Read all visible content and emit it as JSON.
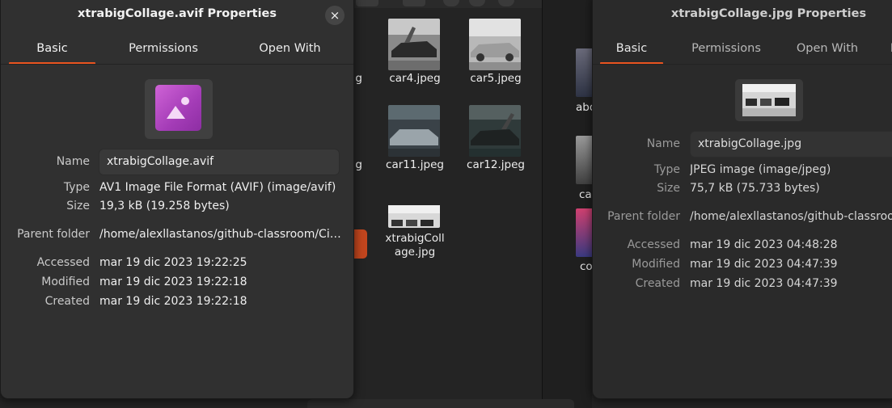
{
  "left_dialog": {
    "title": "xtrabigCollage.avif Properties",
    "close_icon": "×",
    "tabs": [
      "Basic",
      "Permissions",
      "Open With"
    ],
    "file_icon": "image-file-icon",
    "name_label": "Name",
    "name_value": "xtrabigCollage.avif",
    "type_label": "Type",
    "type_value": "AV1 Image File Format (AVIF) (image/avif)",
    "size_label": "Size",
    "size_value": "19,3 kB (19.258 bytes)",
    "parent_label": "Parent folder",
    "parent_value": "/home/alexllastanos/github-classroom/Ci…",
    "accessed_label": "Accessed",
    "accessed_value": "mar 19 dic 2023 19:22:25",
    "modified_label": "Modified",
    "modified_value": "mar 19 dic 2023 19:22:18",
    "created_label": "Created",
    "created_value": "mar 19 dic 2023 19:22:18"
  },
  "right_dialog": {
    "title": "xtrabigCollage.jpg Properties",
    "tabs": [
      "Basic",
      "Permissions",
      "Open With",
      "I"
    ],
    "name_label": "Name",
    "name_value": "xtrabigCollage.jpg",
    "type_label": "Type",
    "type_value": "JPEG image (image/jpeg)",
    "size_label": "Size",
    "size_value": "75,7 kB (75.733 bytes)",
    "parent_label": "Parent folder",
    "parent_value": "/home/alexllastanos/github-classroom",
    "accessed_label": "Accessed",
    "accessed_value": "mar 19 dic 2023 04:48:28",
    "modified_label": "Modified",
    "modified_value": "mar 19 dic 2023 04:47:39",
    "created_label": "Created",
    "created_value": "mar 19 dic 2023 04:47:39"
  },
  "file_grid": {
    "items": [
      "car4.jpeg",
      "car5.jpeg",
      "car11.jpeg",
      "car12.jpeg",
      "xtrabigColl",
      "age.jpg"
    ],
    "partial_labels": [
      "g",
      "g"
    ]
  },
  "right_list": {
    "partial_labels": [
      "abo",
      "ca",
      "co"
    ]
  },
  "colors": {
    "accent": "#e95420",
    "dialog_bg": "#303030",
    "icon_gradient_start": "#cf63d6",
    "icon_gradient_end": "#8d2ea3"
  }
}
